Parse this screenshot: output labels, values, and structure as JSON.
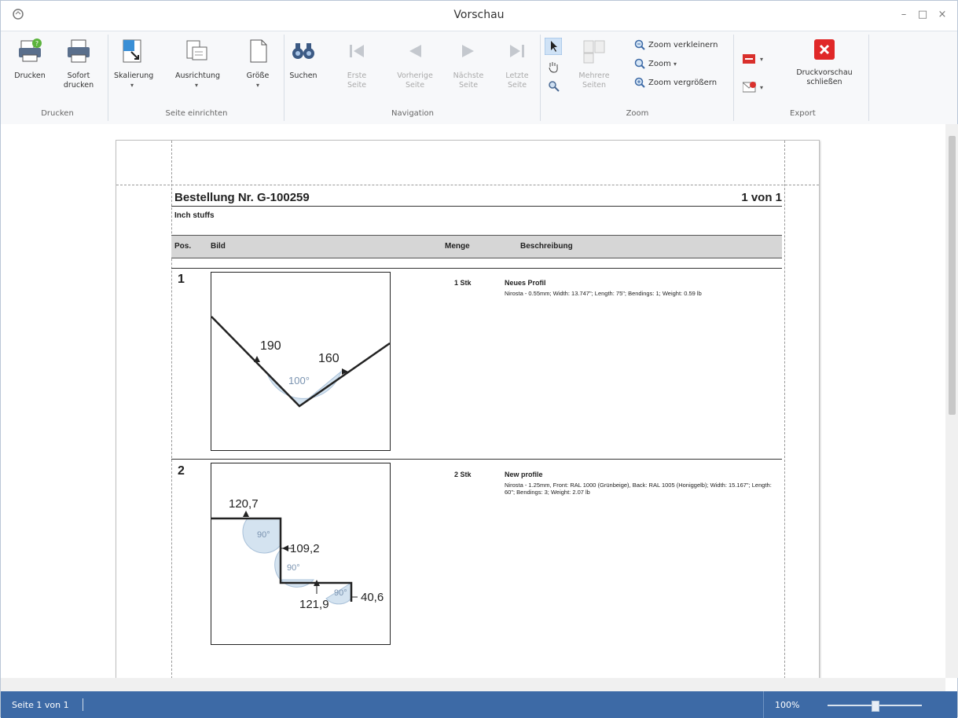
{
  "window": {
    "title": "Vorschau",
    "minimize": "–",
    "maximize": "□",
    "close": "×"
  },
  "ribbon": {
    "groups": {
      "print": "Drucken",
      "setup": "Seite einrichten",
      "navigation": "Navigation",
      "zoom": "Zoom",
      "export": "Export"
    },
    "buttons": {
      "print": "Drucken",
      "quick_print": "Sofort drucken",
      "scaling": "Skalierung",
      "orientation": "Ausrichtung",
      "size": "Größe",
      "search": "Suchen",
      "first_page": "Erste Seite",
      "prev_page": "Vorherige Seite",
      "next_page": "Nächste Seite",
      "last_page": "Letzte Seite",
      "multiple_pages": "Mehrere Seiten",
      "zoom_out": "Zoom verkleinern",
      "zoom": "Zoom",
      "zoom_in": "Zoom vergrößern",
      "close_preview": "Druckvorschau schließen"
    },
    "colors": {
      "export_pdf": "#d9302c",
      "close_red": "#e02828"
    }
  },
  "document": {
    "title": "Bestellung Nr. G-100259",
    "page_of": "1 von 1",
    "subtitle": "Inch stuffs",
    "headers": {
      "pos": "Pos.",
      "image": "Bild",
      "qty": "Menge",
      "desc": "Beschreibung"
    },
    "items": [
      {
        "pos": "1",
        "qty": "1 Stk",
        "name": "Neues Profil",
        "desc": "Nirosta - 0.55mm; Width: 13.747\"; Length: 75\"; Bendings: 1; Weight: 0.59 lb",
        "drawing": {
          "a": "190",
          "b": "160",
          "angle": "100°"
        }
      },
      {
        "pos": "2",
        "qty": "2 Stk",
        "name": "New profile",
        "desc": "Nirosta - 1.25mm, Front: RAL 1000 (Grünbeige), Back: RAL 1005 (Honiggelb); Width: 15.167\"; Length: 60\"; Bendings: 3; Weight: 2.07 lb",
        "drawing": {
          "a": "120,7",
          "b": "109,2",
          "c": "121,9",
          "d": "40,6",
          "angle1": "90°",
          "angle2": "90°",
          "angle3": "90°"
        }
      }
    ]
  },
  "statusbar": {
    "page": "Seite 1 von 1",
    "zoom": "100%",
    "zoom_level": 1.0
  }
}
